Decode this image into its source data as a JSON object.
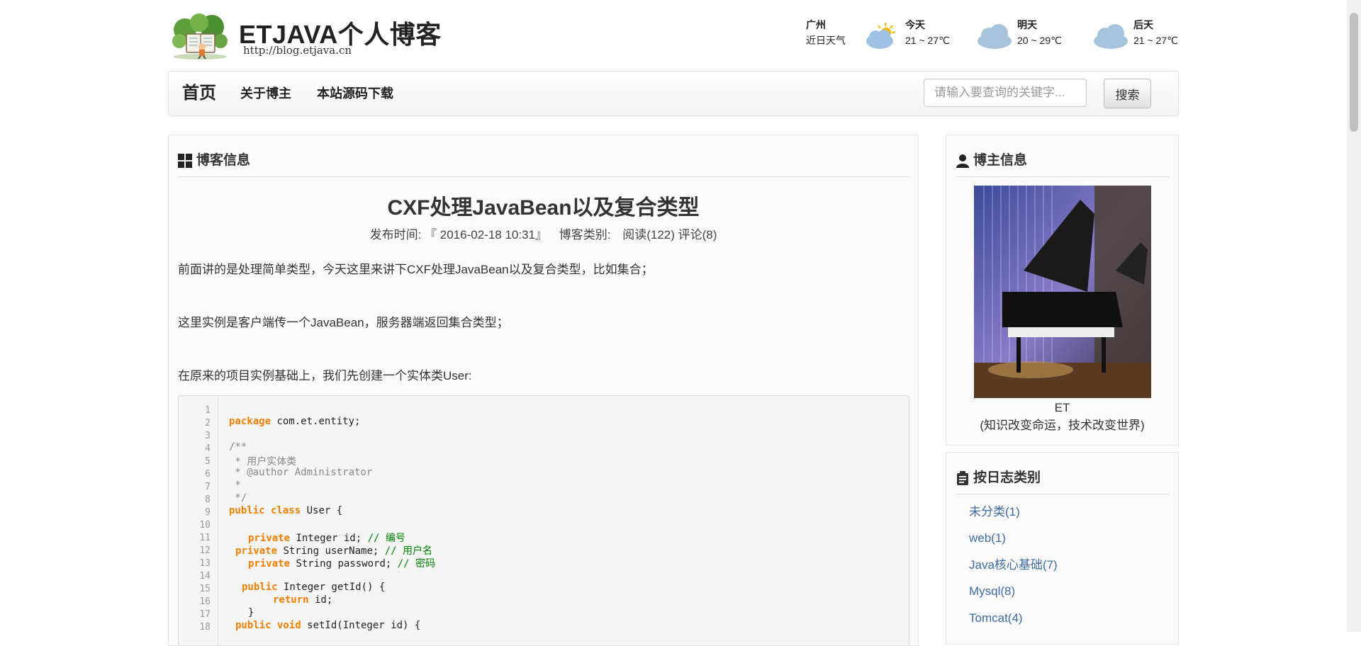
{
  "header": {
    "logo_title": "ETJAVA个人博客",
    "logo_url": "http://blog.etjava.cn",
    "weather": {
      "city": "广州",
      "caption": "近日天气",
      "days": [
        {
          "label": "今天",
          "temp": "21 ~ 27℃",
          "icon": "partly-sunny-icon"
        },
        {
          "label": "明天",
          "temp": "20 ~ 29℃",
          "icon": "cloud-icon"
        },
        {
          "label": "后天",
          "temp": "21 ~ 27℃",
          "icon": "cloud-icon"
        }
      ]
    }
  },
  "nav": {
    "home": "首页",
    "about": "关于博主",
    "source": "本站源码下载",
    "search_placeholder": "请输入要查询的关键字...",
    "search_button": "搜索"
  },
  "main": {
    "panel_title": "博客信息",
    "post_title": "CXF处理JavaBean以及复合类型",
    "meta": {
      "publish": "发布时间: 『 2016-02-18 10:31』",
      "category": "博客类别:",
      "stats": "阅读(122) 评论(8)"
    },
    "paragraphs": [
      "前面讲的是处理简单类型，今天这里来讲下CXF处理JavaBean以及复合类型，比如集合；",
      "这里实例是客户端传一个JavaBean，服务器端返回集合类型；",
      "在原来的项目实例基础上，我们先创建一个实体类User:"
    ],
    "code": {
      "line_numbers": [
        "1",
        "2",
        "3",
        "4",
        "5",
        "6",
        "7",
        "8",
        "9",
        "10",
        "11",
        "12",
        "13",
        "14",
        "15",
        "16",
        "17",
        "18"
      ],
      "l2_kw": "package",
      "l2_rest": " com.et.entity;",
      "l4": "/**",
      "l5": " * 用户实体类",
      "l6": " * @author Administrator",
      "l7": " *",
      "l8": " */",
      "l9_kw": "public class",
      "l9_rest": " User {",
      "l11_kw": "private",
      "l11_rest": " Integer id; ",
      "l11_cm": "// 编号",
      "l12_kw": "private",
      "l12_rest": " String userName; ",
      "l12_cm": "// 用户名",
      "l13_kw": "private",
      "l13_rest": " String password; ",
      "l13_cm": "// 密码",
      "l15_kw": "public",
      "l15_rest": " Integer getId() {",
      "l16_kw": "return",
      "l16_rest": " id;",
      "l17": "}",
      "l18_kw": "public void",
      "l18_rest": " setId(Integer id) {"
    }
  },
  "side": {
    "author_title": "博主信息",
    "author_name": "ET",
    "author_motto": "(知识改变命运，技术改变世界)",
    "category_title": "按日志类别",
    "categories": [
      "未分类(1)",
      "web(1)",
      "Java核心基础(7)",
      "Mysql(8)",
      "Tomcat(4)"
    ]
  }
}
